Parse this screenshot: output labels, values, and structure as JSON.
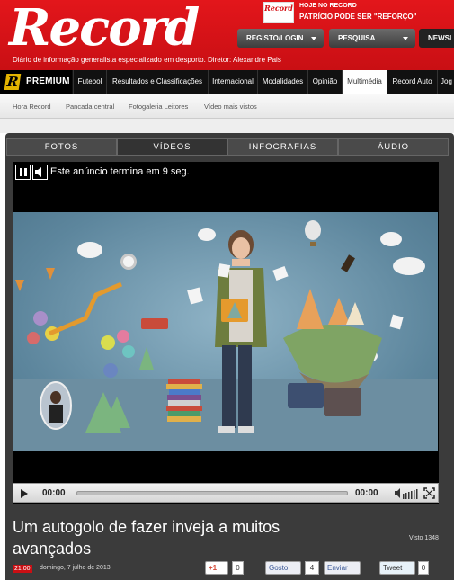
{
  "header": {
    "logo": "Record",
    "tagline": "Diário de informação generalista especializado em desporto. Diretor: Alexandre Pais",
    "promo_thumb": "Record",
    "promo_line1": "HOJE NO RECORD",
    "promo_line2": "PATRÍCIO PODE SER \"REFORÇO\"",
    "login_label": "REGISTO/LOGIN",
    "search_label": "PESQUISA",
    "newsletter_label": "NEWSL"
  },
  "nav": {
    "premium_badge": "R",
    "premium_label": "PREMIUM",
    "items": [
      "Futebol",
      "Resultados e Classificações",
      "Internacional",
      "Modalidades",
      "Opinião",
      "Multimédia",
      "Record Auto",
      "Jog"
    ],
    "active": "Multimédia"
  },
  "subnav": {
    "items": [
      "Hora Record",
      "Pancada central",
      "Fotogaleria Leitores",
      "Vídeo mais vistos"
    ]
  },
  "media_tabs": [
    "FOTOS",
    "VÍDEOS",
    "INFOGRAFIAS",
    "ÁUDIO"
  ],
  "player": {
    "ad_text": "Este anúncio termina em 9 seg.",
    "time_current": "00:00",
    "time_total": "00:00",
    "progress": 0
  },
  "article": {
    "title": "Um autogolo de fazer inveja a muitos avançados",
    "views": "Visto 1348",
    "time": "21:00",
    "date": "domingo, 7 julho de 2013"
  },
  "social": {
    "gplus_label": "+1",
    "gplus_count": "0",
    "fb_label": "Gosto",
    "fb_count": "4",
    "send_label": "Enviar",
    "tweet_label": "Tweet",
    "tweet_count": "0"
  },
  "colors": {
    "brand_red": "#e3161b",
    "nav_bg": "#111111",
    "panel_bg": "#3b3b3b"
  }
}
